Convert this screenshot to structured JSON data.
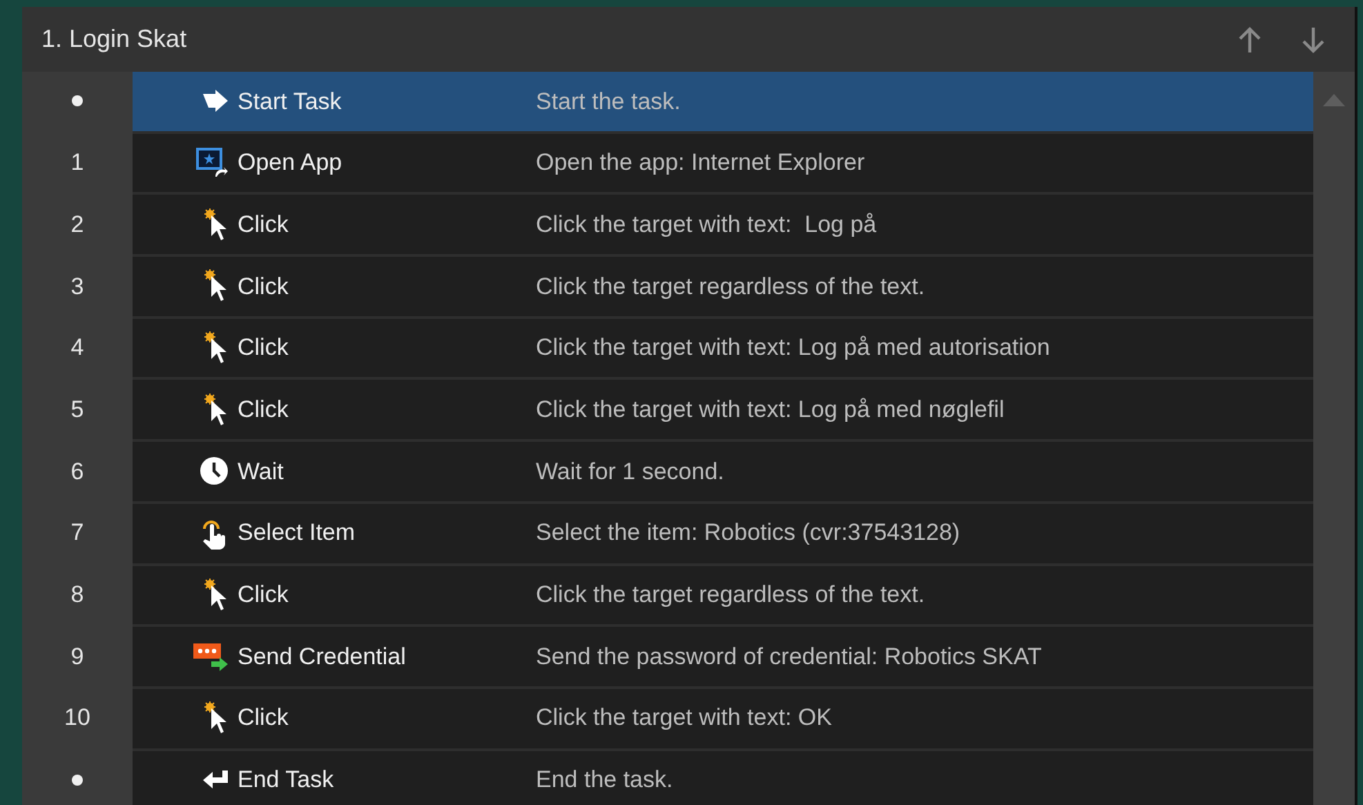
{
  "panel": {
    "title": "1. Login Skat"
  },
  "steps": [
    {
      "kind": "start",
      "name": "Start Task",
      "description": "Start the task.",
      "selected": true
    },
    {
      "kind": "open-app",
      "number": "1",
      "name": "Open App",
      "description": "Open the app: Internet Explorer",
      "selected": false
    },
    {
      "kind": "click",
      "number": "2",
      "name": "Click",
      "description": "Click the target with text:  Log på",
      "selected": false
    },
    {
      "kind": "click",
      "number": "3",
      "name": "Click",
      "description": "Click the target regardless of the text.",
      "selected": false
    },
    {
      "kind": "click",
      "number": "4",
      "name": "Click",
      "description": "Click the target with text: Log på med autorisation",
      "selected": false
    },
    {
      "kind": "click",
      "number": "5",
      "name": "Click",
      "description": "Click the target with text: Log på med nøglefil",
      "selected": false
    },
    {
      "kind": "wait",
      "number": "6",
      "name": "Wait",
      "description": "Wait for 1 second.",
      "selected": false
    },
    {
      "kind": "select",
      "number": "7",
      "name": "Select Item",
      "description": "Select the item: Robotics (cvr:37543128)",
      "selected": false
    },
    {
      "kind": "click",
      "number": "8",
      "name": "Click",
      "description": "Click the target regardless of the text.",
      "selected": false
    },
    {
      "kind": "credential",
      "number": "9",
      "name": "Send Credential",
      "description": "Send the password of credential: Robotics SKAT",
      "selected": false
    },
    {
      "kind": "click",
      "number": "10",
      "name": "Click",
      "description": "Click the target with text: OK",
      "selected": false
    },
    {
      "kind": "end",
      "name": "End Task",
      "description": "End the task.",
      "selected": false
    }
  ]
}
